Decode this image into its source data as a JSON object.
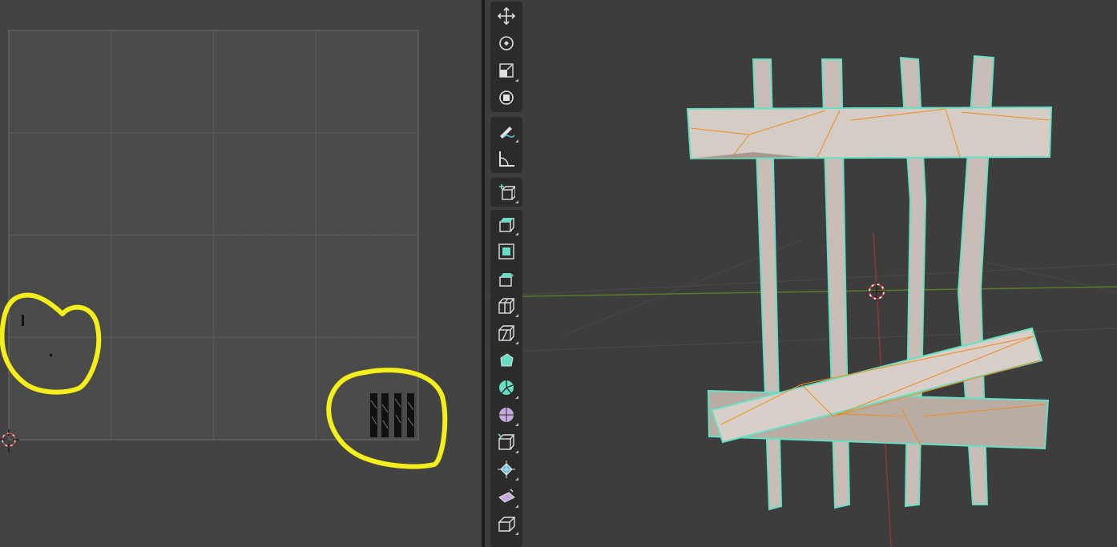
{
  "uv_editor": {
    "grid_color": "#555555",
    "grid_border_color": "#6d6d6d",
    "highlight_color": "#f4ee1a",
    "island_color": "#101010"
  },
  "viewport_3d": {
    "background": "#3d3d3d",
    "mesh_fill": "#cfc4bd",
    "mesh_outline_color": "#66e0c4",
    "edge_color": "#f08a1e",
    "x_axis_color": "#8a3a3a",
    "y_axis_color": "#5b7a2c",
    "cursor_icon": "3d-cursor-icon"
  },
  "toolbar": {
    "tools": [
      {
        "icon": "move-icon"
      },
      {
        "icon": "rotate-icon"
      },
      {
        "icon": "scale-icon"
      },
      {
        "icon": "transform-icon"
      },
      {
        "icon": "annotate-icon"
      },
      {
        "icon": "measure-icon"
      },
      {
        "icon": "add-cube-icon"
      },
      {
        "icon": "extrude-region-icon"
      },
      {
        "icon": "inset-faces-icon"
      },
      {
        "icon": "bevel-icon"
      },
      {
        "icon": "loop-cut-icon"
      },
      {
        "icon": "knife-icon"
      },
      {
        "icon": "poly-build-icon"
      },
      {
        "icon": "spin-icon"
      },
      {
        "icon": "smooth-icon"
      },
      {
        "icon": "edge-slide-icon"
      },
      {
        "icon": "shrink-fatten-icon"
      },
      {
        "icon": "shear-icon"
      },
      {
        "icon": "rip-region-icon"
      }
    ]
  }
}
